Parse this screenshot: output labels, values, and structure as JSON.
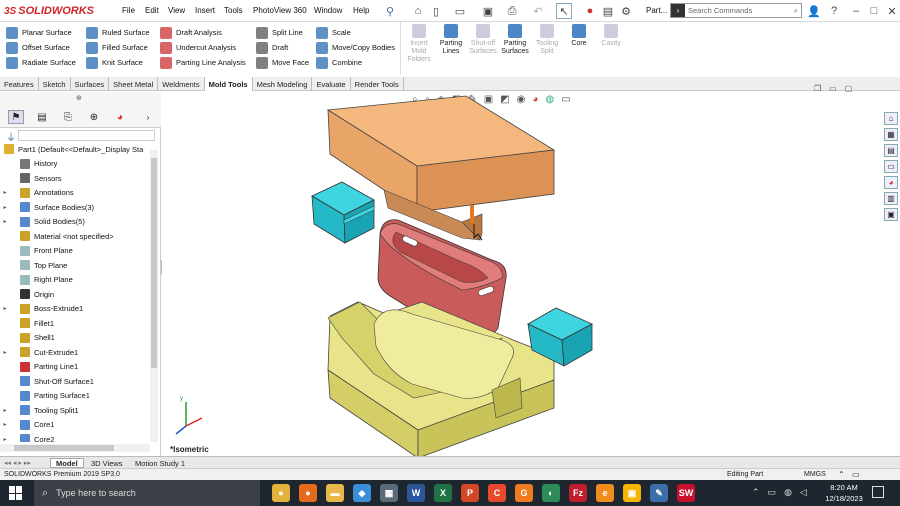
{
  "app": {
    "logo_text": "SOLIDWORKS",
    "logo_prefix": "3S"
  },
  "menu": [
    "File",
    "Edit",
    "View",
    "Insert",
    "Tools",
    "PhotoView 360",
    "Window",
    "Help"
  ],
  "title_doc": "Part...",
  "search": {
    "placeholder": "Search Commands"
  },
  "window_controls": {
    "help": "?",
    "minimize": "–",
    "restore": "□",
    "close": "✕"
  },
  "commands": {
    "col1": [
      {
        "label": "Planar Surface",
        "color": "#2b6cb0"
      },
      {
        "label": "Offset Surface",
        "color": "#2b6cb0"
      },
      {
        "label": "Radiate Surface",
        "color": "#2b6cb0"
      }
    ],
    "col2": [
      {
        "label": "Ruled Surface",
        "color": "#2b6cb0"
      },
      {
        "label": "Filled Surface",
        "color": "#2b6cb0"
      },
      {
        "label": "Knit Surface",
        "color": "#2b6cb0"
      }
    ],
    "col3": [
      {
        "label": "Draft Analysis",
        "color": "#cc3333"
      },
      {
        "label": "Undercut Analysis",
        "color": "#cc3333"
      },
      {
        "label": "Parting Line Analysis",
        "color": "#cc3333"
      }
    ],
    "col4": [
      {
        "label": "Split Line",
        "color": "#555"
      },
      {
        "label": "Draft",
        "color": "#555"
      },
      {
        "label": "Move Face",
        "color": "#555"
      }
    ],
    "col5": [
      {
        "label": "Scale",
        "color": "#2b6cb0"
      },
      {
        "label": "Move/Copy Bodies",
        "color": "#2b6cb0"
      },
      {
        "label": "Combine",
        "color": "#2b6cb0"
      }
    ],
    "big": [
      {
        "label": "Insert Mold Folders",
        "enabled": false
      },
      {
        "label": "Parting Lines",
        "enabled": true
      },
      {
        "label": "Shut-off Surfaces",
        "enabled": false
      },
      {
        "label": "Parting Surfaces",
        "enabled": true
      },
      {
        "label": "Tooling Split",
        "enabled": false
      },
      {
        "label": "Core",
        "enabled": true
      },
      {
        "label": "Cavity",
        "enabled": false
      }
    ]
  },
  "tabs": [
    {
      "label": "Features",
      "active": false
    },
    {
      "label": "Sketch",
      "active": false
    },
    {
      "label": "Surfaces",
      "active": false
    },
    {
      "label": "Sheet Metal",
      "active": false
    },
    {
      "label": "Weldments",
      "active": false
    },
    {
      "label": "Mold Tools",
      "active": true
    },
    {
      "label": "Mesh Modeling",
      "active": false
    },
    {
      "label": "Evaluate",
      "active": false
    },
    {
      "label": "Render Tools",
      "active": false
    }
  ],
  "tree": {
    "root": "Part1  (Default<<Default>_Display Sta",
    "items": [
      {
        "label": "History",
        "expand": false,
        "icon": "history-icon",
        "color": "#777"
      },
      {
        "label": "Sensors",
        "expand": false,
        "icon": "sensor-icon",
        "color": "#666"
      },
      {
        "label": "Annotations",
        "expand": true,
        "icon": "annotation-icon",
        "color": "#c9a227"
      },
      {
        "label": "Surface Bodies(3)",
        "expand": true,
        "icon": "surface-bodies-icon",
        "color": "#5588cc"
      },
      {
        "label": "Solid Bodies(5)",
        "expand": true,
        "icon": "solid-bodies-icon",
        "color": "#5588cc"
      },
      {
        "label": "Material <not specified>",
        "expand": false,
        "icon": "material-icon",
        "color": "#c9a227"
      },
      {
        "label": "Front Plane",
        "expand": false,
        "icon": "plane-icon",
        "color": "#9bb"
      },
      {
        "label": "Top Plane",
        "expand": false,
        "icon": "plane-icon",
        "color": "#9bb"
      },
      {
        "label": "Right Plane",
        "expand": false,
        "icon": "plane-icon",
        "color": "#9bb"
      },
      {
        "label": "Origin",
        "expand": false,
        "icon": "origin-icon",
        "color": "#333"
      },
      {
        "label": "Boss-Extrude1",
        "expand": true,
        "icon": "extrude-icon",
        "color": "#c9a227"
      },
      {
        "label": "Fillet1",
        "expand": false,
        "icon": "fillet-icon",
        "color": "#c9a227"
      },
      {
        "label": "Shell1",
        "expand": false,
        "icon": "shell-icon",
        "color": "#c9a227"
      },
      {
        "label": "Cut-Extrude1",
        "expand": true,
        "icon": "cut-icon",
        "color": "#c9a227"
      },
      {
        "label": "Parting Line1",
        "expand": false,
        "icon": "parting-line-icon",
        "color": "#cc3333"
      },
      {
        "label": "Shut-Off Surface1",
        "expand": false,
        "icon": "shutoff-icon",
        "color": "#5588cc"
      },
      {
        "label": "Parting Surface1",
        "expand": false,
        "icon": "parting-surface-icon",
        "color": "#5588cc"
      },
      {
        "label": "Tooling Split1",
        "expand": true,
        "icon": "tooling-split-icon",
        "color": "#5588cc"
      },
      {
        "label": "Core1",
        "expand": true,
        "icon": "core-icon",
        "color": "#5588cc"
      },
      {
        "label": "Core2",
        "expand": true,
        "icon": "core-icon",
        "color": "#5588cc"
      }
    ]
  },
  "viewport": {
    "view_label": "*Isometric"
  },
  "bottom_tabs": [
    {
      "label": "Model",
      "active": true
    },
    {
      "label": "3D Views",
      "active": false
    },
    {
      "label": "Motion Study 1",
      "active": false
    }
  ],
  "status": {
    "product": "SOLIDWORKS Premium 2019 SP3.0",
    "mode": "Editing Part",
    "units": "MMGS"
  },
  "taskbar": {
    "search_placeholder": "Type here to search",
    "time": "8:20 AM",
    "date": "12/18/2023"
  },
  "taskbar_apps": [
    {
      "name": "chrome",
      "color": "#e2b33b",
      "glyph": "●"
    },
    {
      "name": "firefox",
      "color": "#e66a1c",
      "glyph": "●"
    },
    {
      "name": "explorer",
      "color": "#e8b84a",
      "glyph": "▬"
    },
    {
      "name": "app4",
      "color": "#3b8ed8",
      "glyph": "◆"
    },
    {
      "name": "calculator",
      "color": "#5c6b7a",
      "glyph": "▦"
    },
    {
      "name": "word",
      "color": "#2b579a",
      "glyph": "W"
    },
    {
      "name": "excel",
      "color": "#217346",
      "glyph": "X"
    },
    {
      "name": "powerpoint",
      "color": "#d24726",
      "glyph": "P"
    },
    {
      "name": "app9",
      "color": "#e84b2c",
      "glyph": "C"
    },
    {
      "name": "app10",
      "color": "#f07b1f",
      "glyph": "G"
    },
    {
      "name": "app11",
      "color": "#2e8b57",
      "glyph": "◐"
    },
    {
      "name": "filezilla",
      "color": "#bf1e2e",
      "glyph": "Fz"
    },
    {
      "name": "app13",
      "color": "#f08c1c",
      "glyph": "e"
    },
    {
      "name": "app14",
      "color": "#f5b400",
      "glyph": "▣"
    },
    {
      "name": "app15",
      "color": "#3b6ea8",
      "glyph": "✎"
    },
    {
      "name": "solidworks",
      "color": "#c8102e",
      "glyph": "SW"
    }
  ]
}
